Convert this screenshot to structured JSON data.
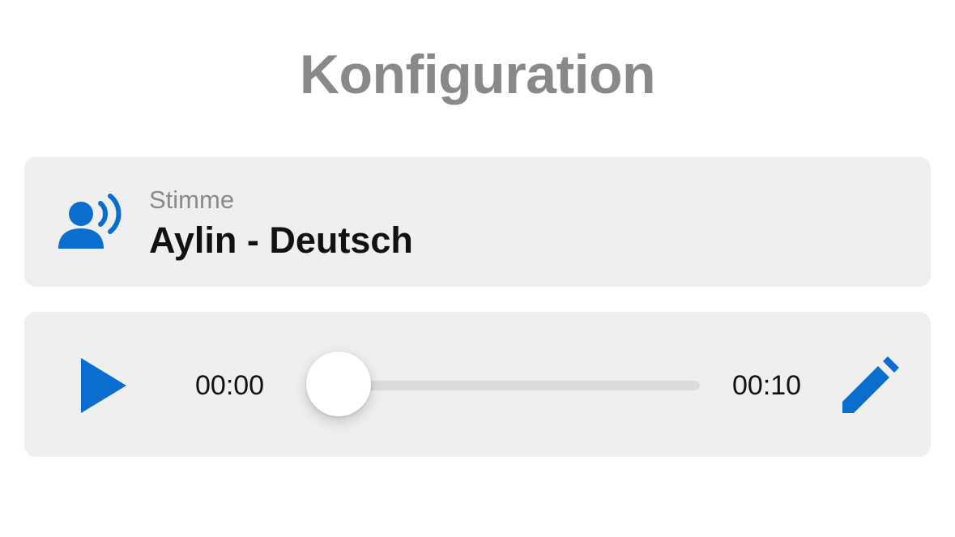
{
  "header": {
    "title": "Konfiguration"
  },
  "voice": {
    "caption": "Stimme",
    "value": "Aylin - Deutsch",
    "icon": "voice-speaker-icon"
  },
  "player": {
    "current_time": "00:00",
    "total_time": "00:10",
    "progress": 0,
    "play_icon": "play-icon",
    "edit_icon": "pencil-icon"
  },
  "colors": {
    "accent": "#0a6ece",
    "card_background": "#efefef",
    "title": "#898989",
    "caption": "#8a8a8a",
    "text": "#111111"
  }
}
